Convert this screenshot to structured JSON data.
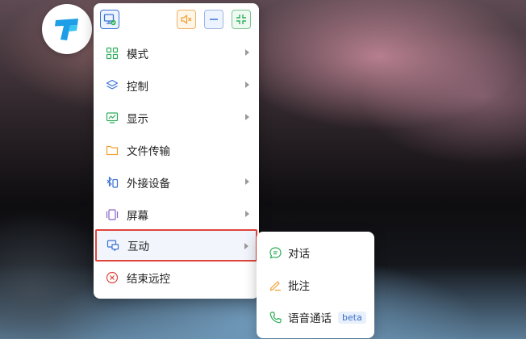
{
  "colors": {
    "accent_red": "#e0453b",
    "blue": "#3a72d6",
    "green": "#2fae5a",
    "orange": "#f0a030",
    "purple": "#8a64c8"
  },
  "logo": {
    "icon": "app-logo-icon"
  },
  "toolbar": {
    "buttons": [
      {
        "icon": "screen-select-icon"
      },
      {
        "icon": "speaker-mute-icon"
      },
      {
        "icon": "minimize-icon"
      },
      {
        "icon": "shrink-icon"
      }
    ]
  },
  "menu": {
    "items": [
      {
        "label": "模式",
        "icon": "grid-icon",
        "has_submenu": true
      },
      {
        "label": "控制",
        "icon": "layers-icon",
        "has_submenu": true
      },
      {
        "label": "显示",
        "icon": "monitor-chart-icon",
        "has_submenu": true
      },
      {
        "label": "文件传输",
        "icon": "folder-icon",
        "has_submenu": false
      },
      {
        "label": "外接设备",
        "icon": "bluetooth-device-icon",
        "has_submenu": true
      },
      {
        "label": "屏幕",
        "icon": "screen-icon",
        "has_submenu": true
      },
      {
        "label": "互动",
        "icon": "chat-screen-icon",
        "has_submenu": true,
        "selected": true
      },
      {
        "label": "结束远控",
        "icon": "close-circle-icon",
        "has_submenu": false
      }
    ]
  },
  "submenu": {
    "items": [
      {
        "label": "对话",
        "icon": "chat-bubble-icon"
      },
      {
        "label": "批注",
        "icon": "pen-icon"
      },
      {
        "label": "语音通话",
        "icon": "phone-icon",
        "badge": "beta"
      }
    ]
  }
}
